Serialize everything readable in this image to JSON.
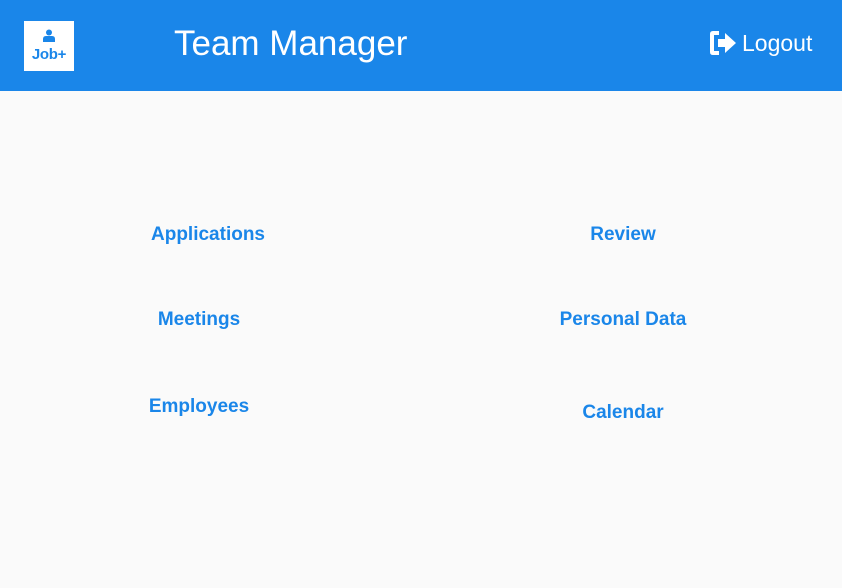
{
  "header": {
    "logo_text": "Job+",
    "title": "Team Manager",
    "logout_label": "Logout"
  },
  "menu": {
    "applications": "Applications",
    "review": "Review",
    "meetings": "Meetings",
    "personal_data": "Personal Data",
    "employees": "Employees",
    "calendar": "Calendar"
  },
  "colors": {
    "primary": "#1a86e9",
    "background": "#fafafa"
  }
}
